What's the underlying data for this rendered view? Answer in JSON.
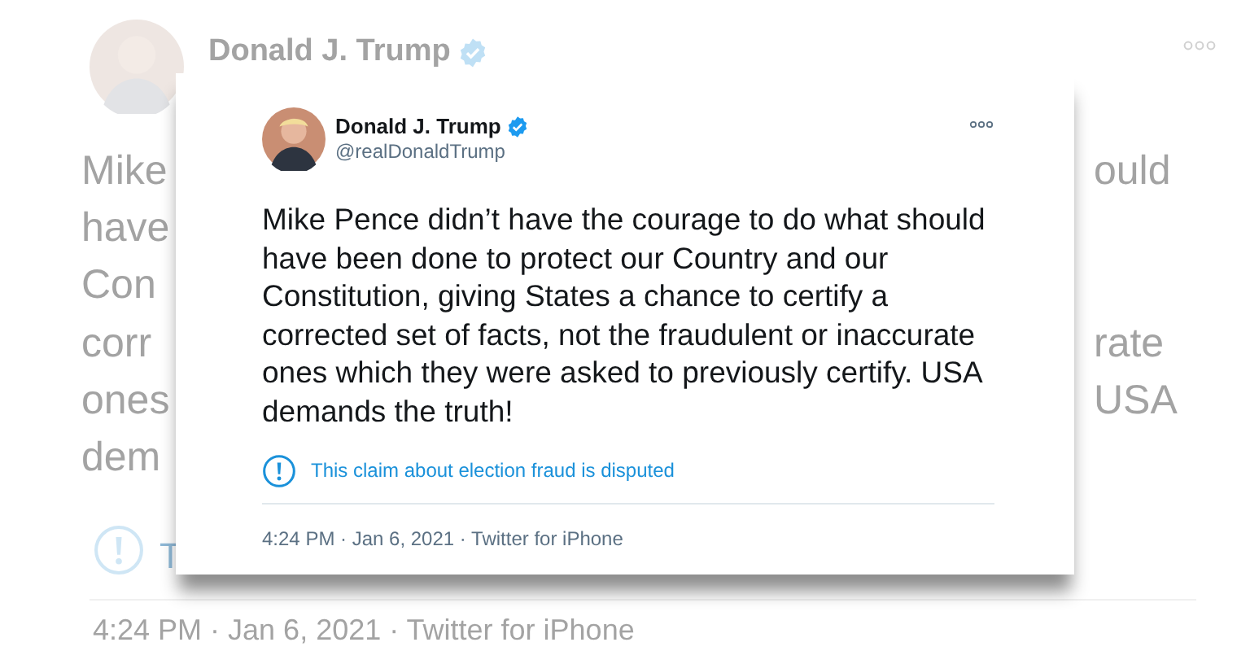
{
  "background": {
    "name": "Donald J. Trump",
    "left_fragments": [
      "Mike",
      "have",
      "Con",
      "corr",
      "ones",
      "dem"
    ],
    "right_fragments": [
      "ould",
      "rate",
      "USA"
    ],
    "notice_fragment": "T",
    "timestamp": "4:24 PM · Jan 6, 2021 · Twitter for iPhone"
  },
  "tweet": {
    "name": "Donald J. Trump",
    "verified": true,
    "handle": "@realDonaldTrump",
    "text": "Mike Pence didn’t have the courage to do what should have been done to protect our Country and our Constitution, giving States a chance to certify a corrected set of facts, not the fraudulent or inaccurate ones which they were asked to previously certify. USA demands the truth!",
    "notice": "This claim about election fraud is disputed",
    "timestamp": "4:24 PM · Jan 6, 2021 · Twitter for iPhone"
  }
}
